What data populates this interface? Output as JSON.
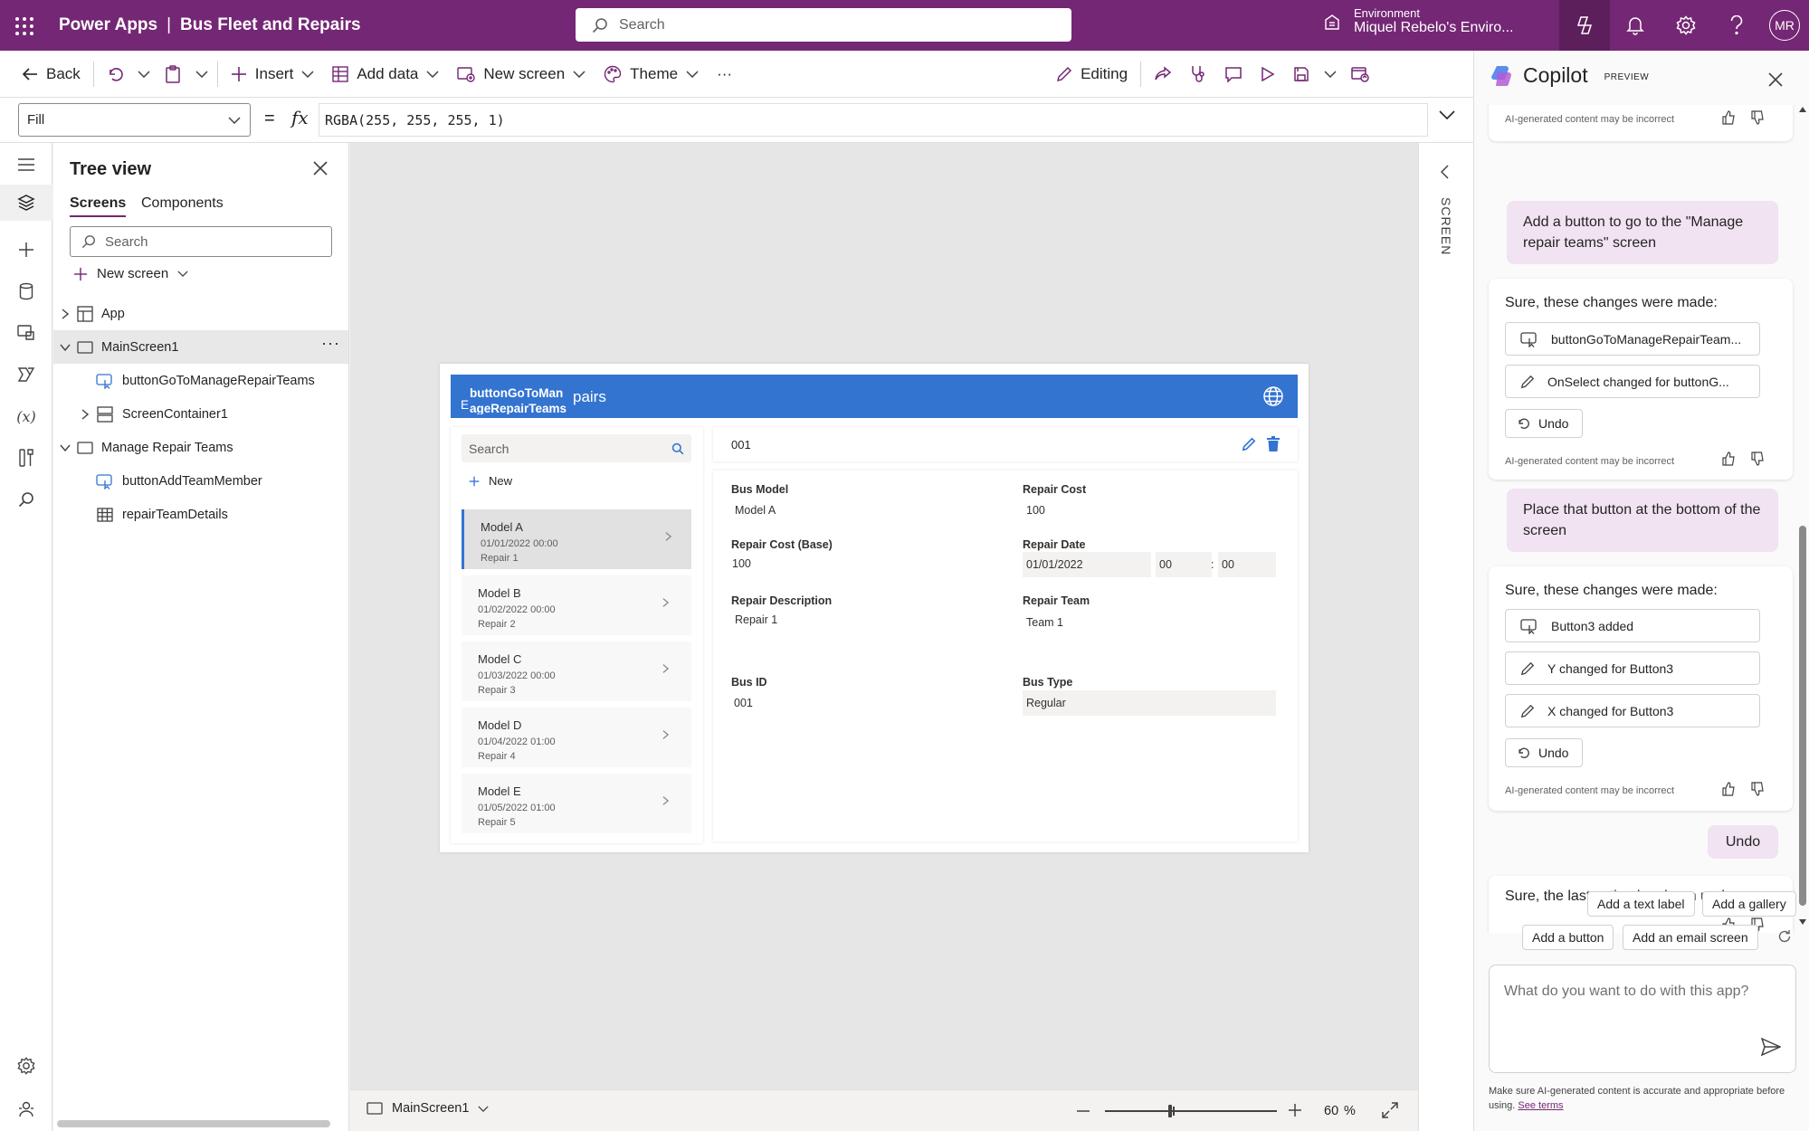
{
  "topbar": {
    "product": "Power Apps",
    "separator": "|",
    "app_name": "Bus Fleet and Repairs",
    "search_placeholder": "Search",
    "environment_label": "Environment",
    "environment_name": "Miquel Rebelo's Enviro...",
    "user_initials": "MR"
  },
  "toolbar": {
    "back": "Back",
    "insert": "Insert",
    "add_data": "Add data",
    "new_screen": "New screen",
    "theme": "Theme",
    "more": "···",
    "editing": "Editing"
  },
  "formula": {
    "property": "Fill",
    "equals": "=",
    "fx": "fx",
    "expression": "RGBA(255, 255, 255, 1)"
  },
  "tree": {
    "title": "Tree view",
    "tabs": [
      "Screens",
      "Components"
    ],
    "search_placeholder": "Search",
    "new_screen": "New screen",
    "items": [
      {
        "label": "App"
      },
      {
        "label": "MainScreen1"
      },
      {
        "label": "buttonGoToManageRepairTeams"
      },
      {
        "label": "ScreenContainer1"
      },
      {
        "label": "Manage Repair Teams"
      },
      {
        "label": "buttonAddTeamMember"
      },
      {
        "label": "repairTeamDetails"
      }
    ],
    "more": "···"
  },
  "canvas": {
    "screen_label": "SCREEN",
    "bottom_screen": "MainScreen1",
    "zoom": "60",
    "zoom_unit": "%",
    "zoom_level": 0.6
  },
  "app": {
    "header_button_line1": "buttonGoToMan",
    "header_button_line2": "ageRepairTeams",
    "header_edge_char": "E",
    "header_title_visible": "pairs",
    "list_search_placeholder": "Search",
    "new_label": "New",
    "list": [
      {
        "model": "Model A",
        "date": "01/01/2022 00:00",
        "repair": "Repair 1"
      },
      {
        "model": "Model B",
        "date": "01/02/2022 00:00",
        "repair": "Repair 2"
      },
      {
        "model": "Model C",
        "date": "01/03/2022 00:00",
        "repair": "Repair 3"
      },
      {
        "model": "Model D",
        "date": "01/04/2022 01:00",
        "repair": "Repair 4"
      },
      {
        "model": "Model E",
        "date": "01/05/2022 01:00",
        "repair": "Repair 5"
      }
    ],
    "detail_id": "001",
    "fields": {
      "bus_model_label": "Bus Model",
      "bus_model": "Model A",
      "repair_cost_label": "Repair Cost",
      "repair_cost": "100",
      "repair_cost_base_label": "Repair Cost (Base)",
      "repair_cost_base": "100",
      "repair_date_label": "Repair Date",
      "repair_date": "01/01/2022",
      "repair_hour": "00",
      "repair_minute": "00",
      "time_sep": ":",
      "repair_desc_label": "Repair Description",
      "repair_desc": "Repair 1",
      "repair_team_label": "Repair Team",
      "repair_team": "Team 1",
      "bus_id_label": "Bus ID",
      "bus_id": "001",
      "bus_type_label": "Bus Type",
      "bus_type": "Regular"
    }
  },
  "copilot": {
    "title": "Copilot",
    "preview": "PREVIEW",
    "ai_disclaimer": "AI-generated content may be incorrect",
    "msg1_user": "Add a button to go to the \"Manage repair teams\" screen",
    "msg1_resp": "Sure, these changes were made:",
    "msg1_changes": [
      "buttonGoToManageRepairTeam...",
      "OnSelect changed for buttonG..."
    ],
    "undo": "Undo",
    "msg2_user": "Place that button at the bottom of the screen",
    "msg2_resp": "Sure, these changes were made:",
    "msg2_changes": [
      "Button3 added",
      "Y changed for Button3",
      "X changed for Button3"
    ],
    "msg3_user": "Undo",
    "msg3_resp": "Sure, the last action has been undone",
    "suggestions": [
      "Add a text label",
      "Add a gallery",
      "Add a button",
      "Add an email screen"
    ],
    "input_placeholder": "What do you want to do with this app?",
    "footer_text": "Make sure AI-generated content is accurate and appropriate before using.",
    "footer_link": "See terms"
  },
  "colors": {
    "brand": "#742774",
    "app_header": "#3374d1",
    "user_bubble": "#f1e3f1"
  }
}
